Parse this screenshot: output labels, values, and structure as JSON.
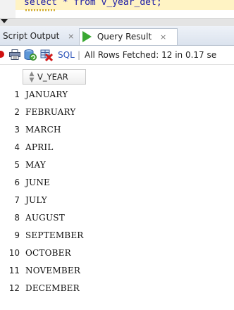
{
  "editor": {
    "sql_text": "select * from v_year_det;"
  },
  "tabs": [
    {
      "label": "Script Output",
      "close": "×"
    },
    {
      "label": "Query Result",
      "close": "×"
    }
  ],
  "toolbar": {
    "sql_label": "SQL",
    "separator": "|",
    "status": "All Rows Fetched: 12 in 0.17 se"
  },
  "grid": {
    "column": "V_YEAR",
    "rows": [
      {
        "n": "1",
        "v": "JANUARY"
      },
      {
        "n": "2",
        "v": "FEBRUARY"
      },
      {
        "n": "3",
        "v": "MARCH"
      },
      {
        "n": "4",
        "v": "APRIL"
      },
      {
        "n": "5",
        "v": "MAY"
      },
      {
        "n": "6",
        "v": "JUNE"
      },
      {
        "n": "7",
        "v": "JULY"
      },
      {
        "n": "8",
        "v": "AUGUST"
      },
      {
        "n": "9",
        "v": "SEPTEMBER"
      },
      {
        "n": "10",
        "v": "OCTOBER"
      },
      {
        "n": "11",
        "v": "NOVEMBER"
      },
      {
        "n": "12",
        "v": "DECEMBER"
      }
    ]
  },
  "colors": {
    "play_green": "#3aa832",
    "sql_blue": "#2a52b8",
    "editor_highlight": "#fff3c4"
  }
}
